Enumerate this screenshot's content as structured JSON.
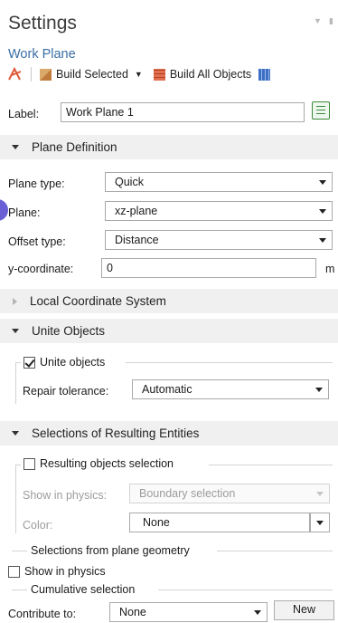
{
  "header": {
    "title": "Settings",
    "subtitle": "Work Plane"
  },
  "toolbar": {
    "build_selected": "Build Selected",
    "build_all": "Build All Objects"
  },
  "label_row": {
    "label": "Label:",
    "value": "Work Plane 1"
  },
  "plane_definition": {
    "title": "Plane Definition",
    "plane_type_label": "Plane type:",
    "plane_type_value": "Quick",
    "plane_label": "Plane:",
    "plane_value": "xz-plane",
    "offset_type_label": "Offset type:",
    "offset_type_value": "Distance",
    "y_coord_label": "y-coordinate:",
    "y_coord_value": "0",
    "y_coord_unit": "m"
  },
  "local_coord": {
    "title": "Local Coordinate System"
  },
  "unite_objects": {
    "title": "Unite Objects",
    "checkbox_label": "Unite objects",
    "checked": true,
    "repair_label": "Repair tolerance:",
    "repair_value": "Automatic"
  },
  "selections": {
    "title": "Selections of Resulting Entities",
    "resulting_label": "Resulting objects selection",
    "resulting_checked": false,
    "show_in_physics_label": "Show in physics:",
    "show_in_physics_value": "Boundary selection",
    "color_label": "Color:",
    "color_value": "None",
    "plane_geometry_title": "Selections from plane geometry",
    "show_in_physics_check_label": "Show in physics",
    "show_in_physics_checked": false,
    "cumulative_title": "Cumulative selection",
    "contribute_label": "Contribute to:",
    "contribute_value": "None",
    "new_button": "New"
  },
  "colors": {
    "accent": "#3a6ea5",
    "section_bg": "#f0f0f0",
    "marker": "#6a60d6"
  }
}
